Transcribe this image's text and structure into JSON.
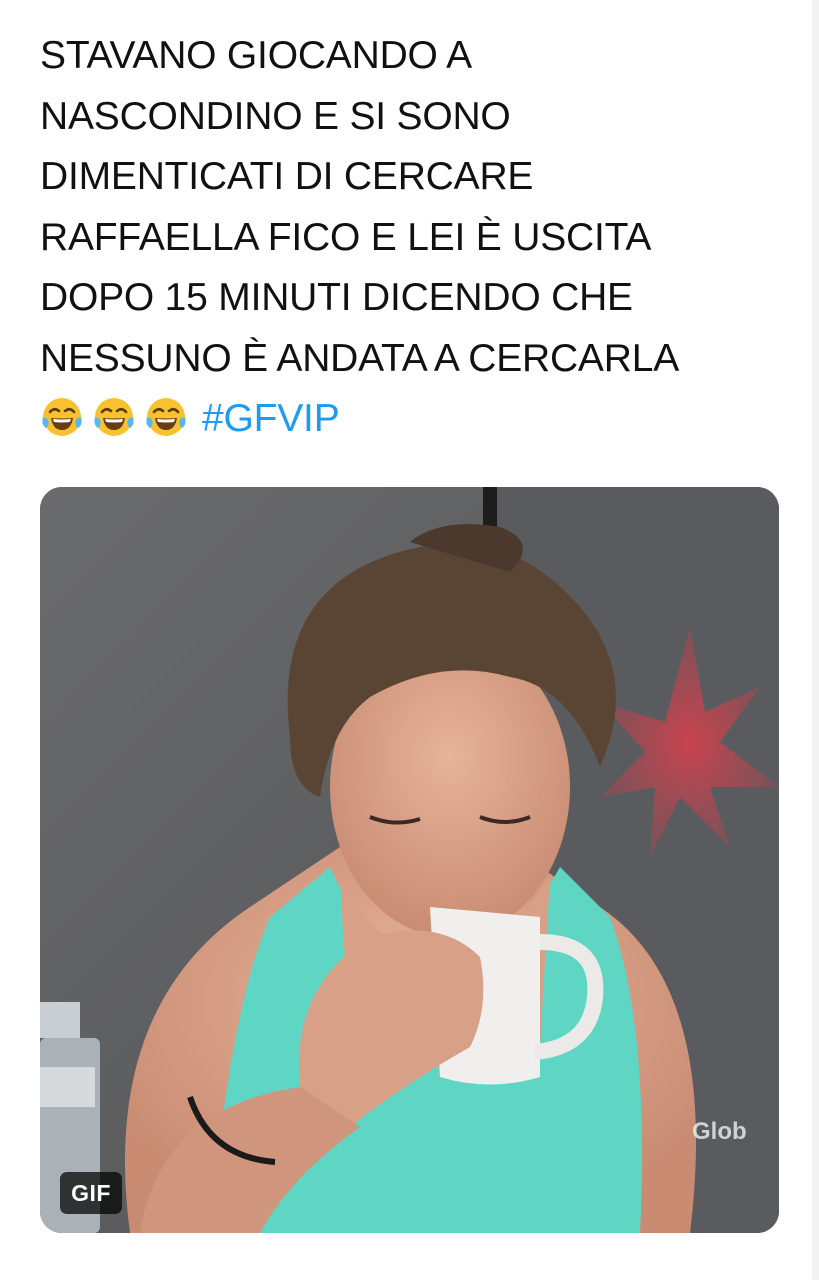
{
  "tweet": {
    "lines": [
      "STAVANO GIOCANDO A",
      "NASCONDINO E SI SONO",
      "DIMENTICATI DI CERCARE",
      "RAFFAELLA FICO E LEI È USCITA",
      "DOPO 15 MINUTI DICENDO CHE",
      "NESSUNO È ANDATA A CERCARLA"
    ],
    "emojis": [
      "face-with-tears-of-joy-icon",
      "face-with-tears-of-joy-icon",
      "face-with-tears-of-joy-icon"
    ],
    "hashtag": "#GFVIP",
    "hashtag_color": "#1d9bf0",
    "text_color": "#111111"
  },
  "media": {
    "badge": "GIF",
    "watermark": "Glob"
  }
}
